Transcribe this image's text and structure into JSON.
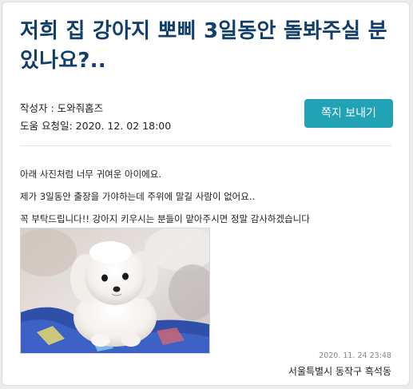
{
  "post": {
    "title": "저희 집 강아지 뽀삐 3일동안 돌봐주실 분 있나요?..",
    "author_label": "작성자 : ",
    "author": "도와줘홈즈",
    "request_date_label": "도움 요청일: ",
    "request_date": "2020. 12. 02 18:00",
    "send_message_label": "쪽지 보내기",
    "body_lines": [
      "아래 사진처럼 너무 귀여운 아이에요.",
      "제가 3일동안 출장을 가야하는데 주위에 말길 사람이 없어요..",
      "꼭 부탁드립니다!! 강아지 키우시는 분들이 맡아주시면 정말 감사하겠습니다"
    ],
    "posted_at": "2020. 11. 24 23:48",
    "location": "서울특별시 동작구 흑석동"
  },
  "colors": {
    "title": "#123e6b",
    "button": "#21a2b5"
  }
}
